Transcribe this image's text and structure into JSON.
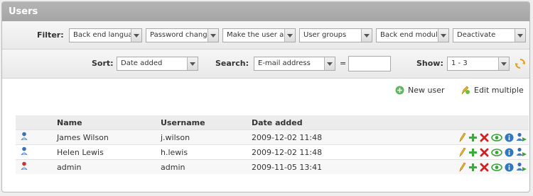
{
  "title": "Users",
  "filter": {
    "label": "Filter:",
    "selects": [
      {
        "value": "Back end langua"
      },
      {
        "value": "Password chang"
      },
      {
        "value": "Make the user a"
      },
      {
        "value": "User groups"
      },
      {
        "value": "Back end module"
      },
      {
        "value": "Deactivate"
      }
    ]
  },
  "sort": {
    "label": "Sort:",
    "value": "Date added"
  },
  "search": {
    "label": "Search:",
    "field": "E-mail address",
    "operator": "=",
    "value": ""
  },
  "show": {
    "label": "Show:",
    "value": "1 - 3"
  },
  "actions": {
    "new_user": "New user",
    "edit_multiple": "Edit multiple"
  },
  "table": {
    "headers": {
      "name": "Name",
      "username": "Username",
      "date": "Date added"
    },
    "rows": [
      {
        "name": "James Wilson",
        "username": "j.wilson",
        "date": "2009-12-02 11:48",
        "admin": false
      },
      {
        "name": "Helen Lewis",
        "username": "h.lewis",
        "date": "2009-12-02 11:48",
        "admin": false
      },
      {
        "name": "admin",
        "username": "admin",
        "date": "2009-11-05 13:41",
        "admin": true
      }
    ]
  },
  "colors": {
    "titlebar": "#aaaaaa",
    "new_user_icon": "#4caf50",
    "delete": "#cc2222",
    "info": "#2f78c4"
  }
}
